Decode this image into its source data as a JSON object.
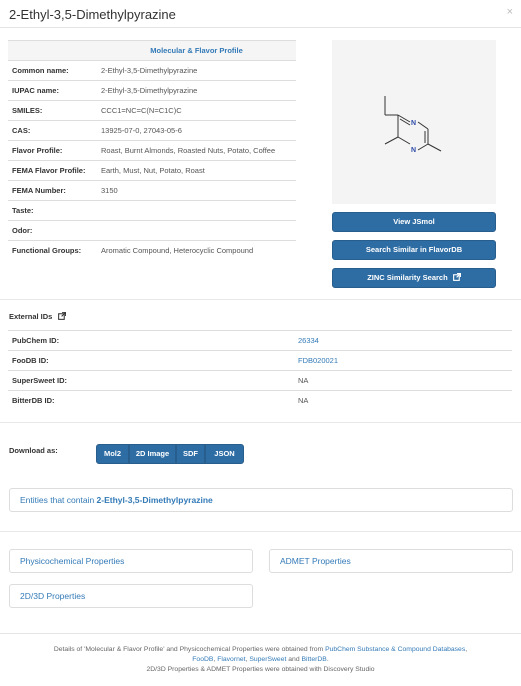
{
  "modal": {
    "title": "2-Ethyl-3,5-Dimethylpyrazine",
    "close_glyph": "×"
  },
  "profile": {
    "heading": "Molecular & Flavor Profile",
    "rows": [
      {
        "key": "Common name:",
        "value": "2-Ethyl-3,5-Dimethylpyrazine"
      },
      {
        "key": "IUPAC name:",
        "value": "2-Ethyl-3,5-Dimethylpyrazine"
      },
      {
        "key": "SMILES:",
        "value": "CCC1=NC=C(N=C1C)C"
      },
      {
        "key": "CAS:",
        "value": "13925-07-0, 27043-05-6"
      },
      {
        "key": "Flavor Profile:",
        "value": "Roast, Burnt Almonds, Roasted Nuts, Potato, Coffee"
      },
      {
        "key": "FEMA Flavor Profile:",
        "value": "Earth, Must, Nut, Potato, Roast"
      },
      {
        "key": "FEMA Number:",
        "value": "3150"
      },
      {
        "key": "Taste:",
        "value": ""
      },
      {
        "key": "Odor:",
        "value": ""
      },
      {
        "key": "Functional Groups:",
        "value": "Aromatic Compound, Heterocyclic Compound"
      }
    ]
  },
  "structure": {
    "atom_n": "N"
  },
  "actions": {
    "view_jsmol": "View JSmol",
    "search_similar": "Search Similar in FlavorDB",
    "zinc_search": "ZINC Similarity Search"
  },
  "external_ids": {
    "label": "External IDs",
    "rows": [
      {
        "key": "PubChem ID:",
        "value": "26334",
        "link": true
      },
      {
        "key": "FooDB ID:",
        "value": "FDB020021",
        "link": true
      },
      {
        "key": "SuperSweet ID:",
        "value": "NA",
        "link": false
      },
      {
        "key": "BitterDB ID:",
        "value": "NA",
        "link": false
      }
    ]
  },
  "download": {
    "label": "Download as:",
    "buttons": [
      "Mol2",
      "2D Image",
      "SDF",
      "JSON"
    ]
  },
  "panels": {
    "entities_prefix": "Entities that contain ",
    "entities_name": "2-Ethyl-3,5-Dimethylpyrazine",
    "physicochemical": "Physicochemical Properties",
    "admet": "ADMET Properties",
    "props_2d3d": "2D/3D Properties"
  },
  "footer": {
    "line1_prefix": "Details of 'Molecular & Flavor Profile' and Physicochemical Properties were obtained from ",
    "pubchem_link": "PubChem Substance & Compound Databases",
    "line1_suffix": ",",
    "foodb": "FooDB",
    "sep1": ", ",
    "flavornet": "Flavornet",
    "sep2": ", ",
    "supersweet": "SuperSweet",
    "and": " and ",
    "bitterdb": "BitterDB",
    "period": ".",
    "line3": "2D/3D Properties & ADMET Properties were obtained with Discovery Studio"
  },
  "colors": {
    "primary": "#2e6da4",
    "link": "#337ab7"
  }
}
